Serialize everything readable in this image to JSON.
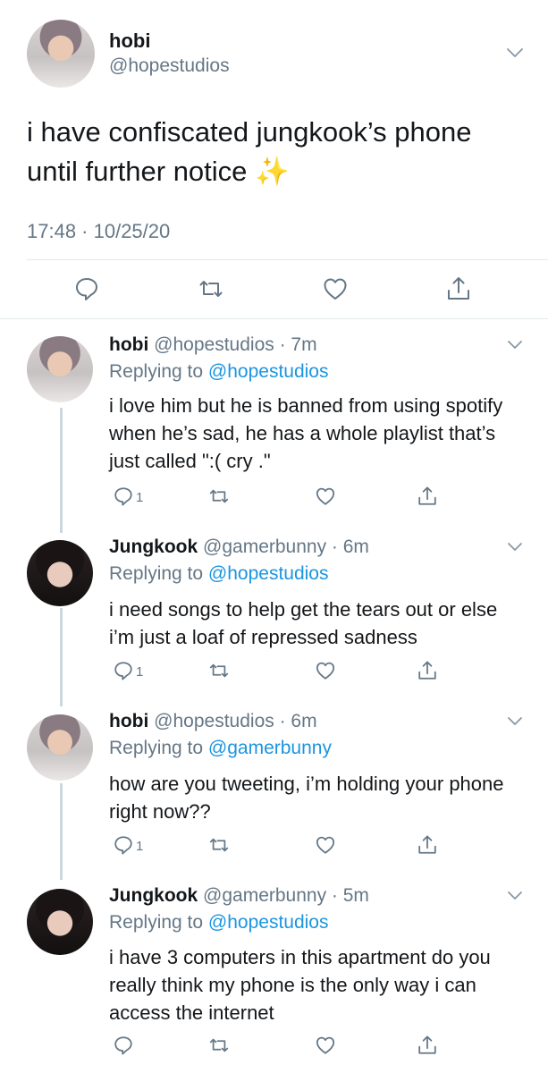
{
  "main_tweet": {
    "name": "hobi",
    "handle": "@hopestudios",
    "text": "i have confiscated jungkook’s phone until further notice ✨",
    "timestamp": "17:48 · 10/25/20"
  },
  "replies": [
    {
      "name": "hobi",
      "handle_time": "@hopestudios · 7m",
      "replying_prefix": "Replying to ",
      "replying_to": "@hopestudios",
      "text": "i love him but he is banned from using spotify when he’s sad, he has a whole playlist that’s just called \":( cry .\"",
      "reply_count": "1"
    },
    {
      "name": "Jungkook",
      "handle_time": "@gamerbunny · 6m",
      "replying_prefix": "Replying to ",
      "replying_to": "@hopestudios",
      "text": "i need songs to help get the tears out or else i’m just a loaf of repressed sadness",
      "reply_count": "1"
    },
    {
      "name": "hobi",
      "handle_time": "@hopestudios · 6m",
      "replying_prefix": "Replying to ",
      "replying_to": "@gamerbunny",
      "text": "how are you tweeting, i’m holding your phone right now??",
      "reply_count": "1"
    },
    {
      "name": "Jungkook",
      "handle_time": "@gamerbunny · 5m",
      "replying_prefix": "Replying to ",
      "replying_to": "@hopestudios",
      "text": "i have 3 computers in this apartment do you really think my phone is the only way i can access the internet",
      "reply_count": ""
    }
  ],
  "icons": {
    "reply": "reply-icon",
    "retweet": "retweet-icon",
    "like": "heart-icon",
    "share": "share-icon",
    "menu": "chevron-down-icon"
  },
  "colors": {
    "link": "#1b95e0",
    "secondary_text": "#657786",
    "icon": "#657786",
    "divider": "#e1e8ed",
    "thread_line": "#ccd6dd"
  }
}
